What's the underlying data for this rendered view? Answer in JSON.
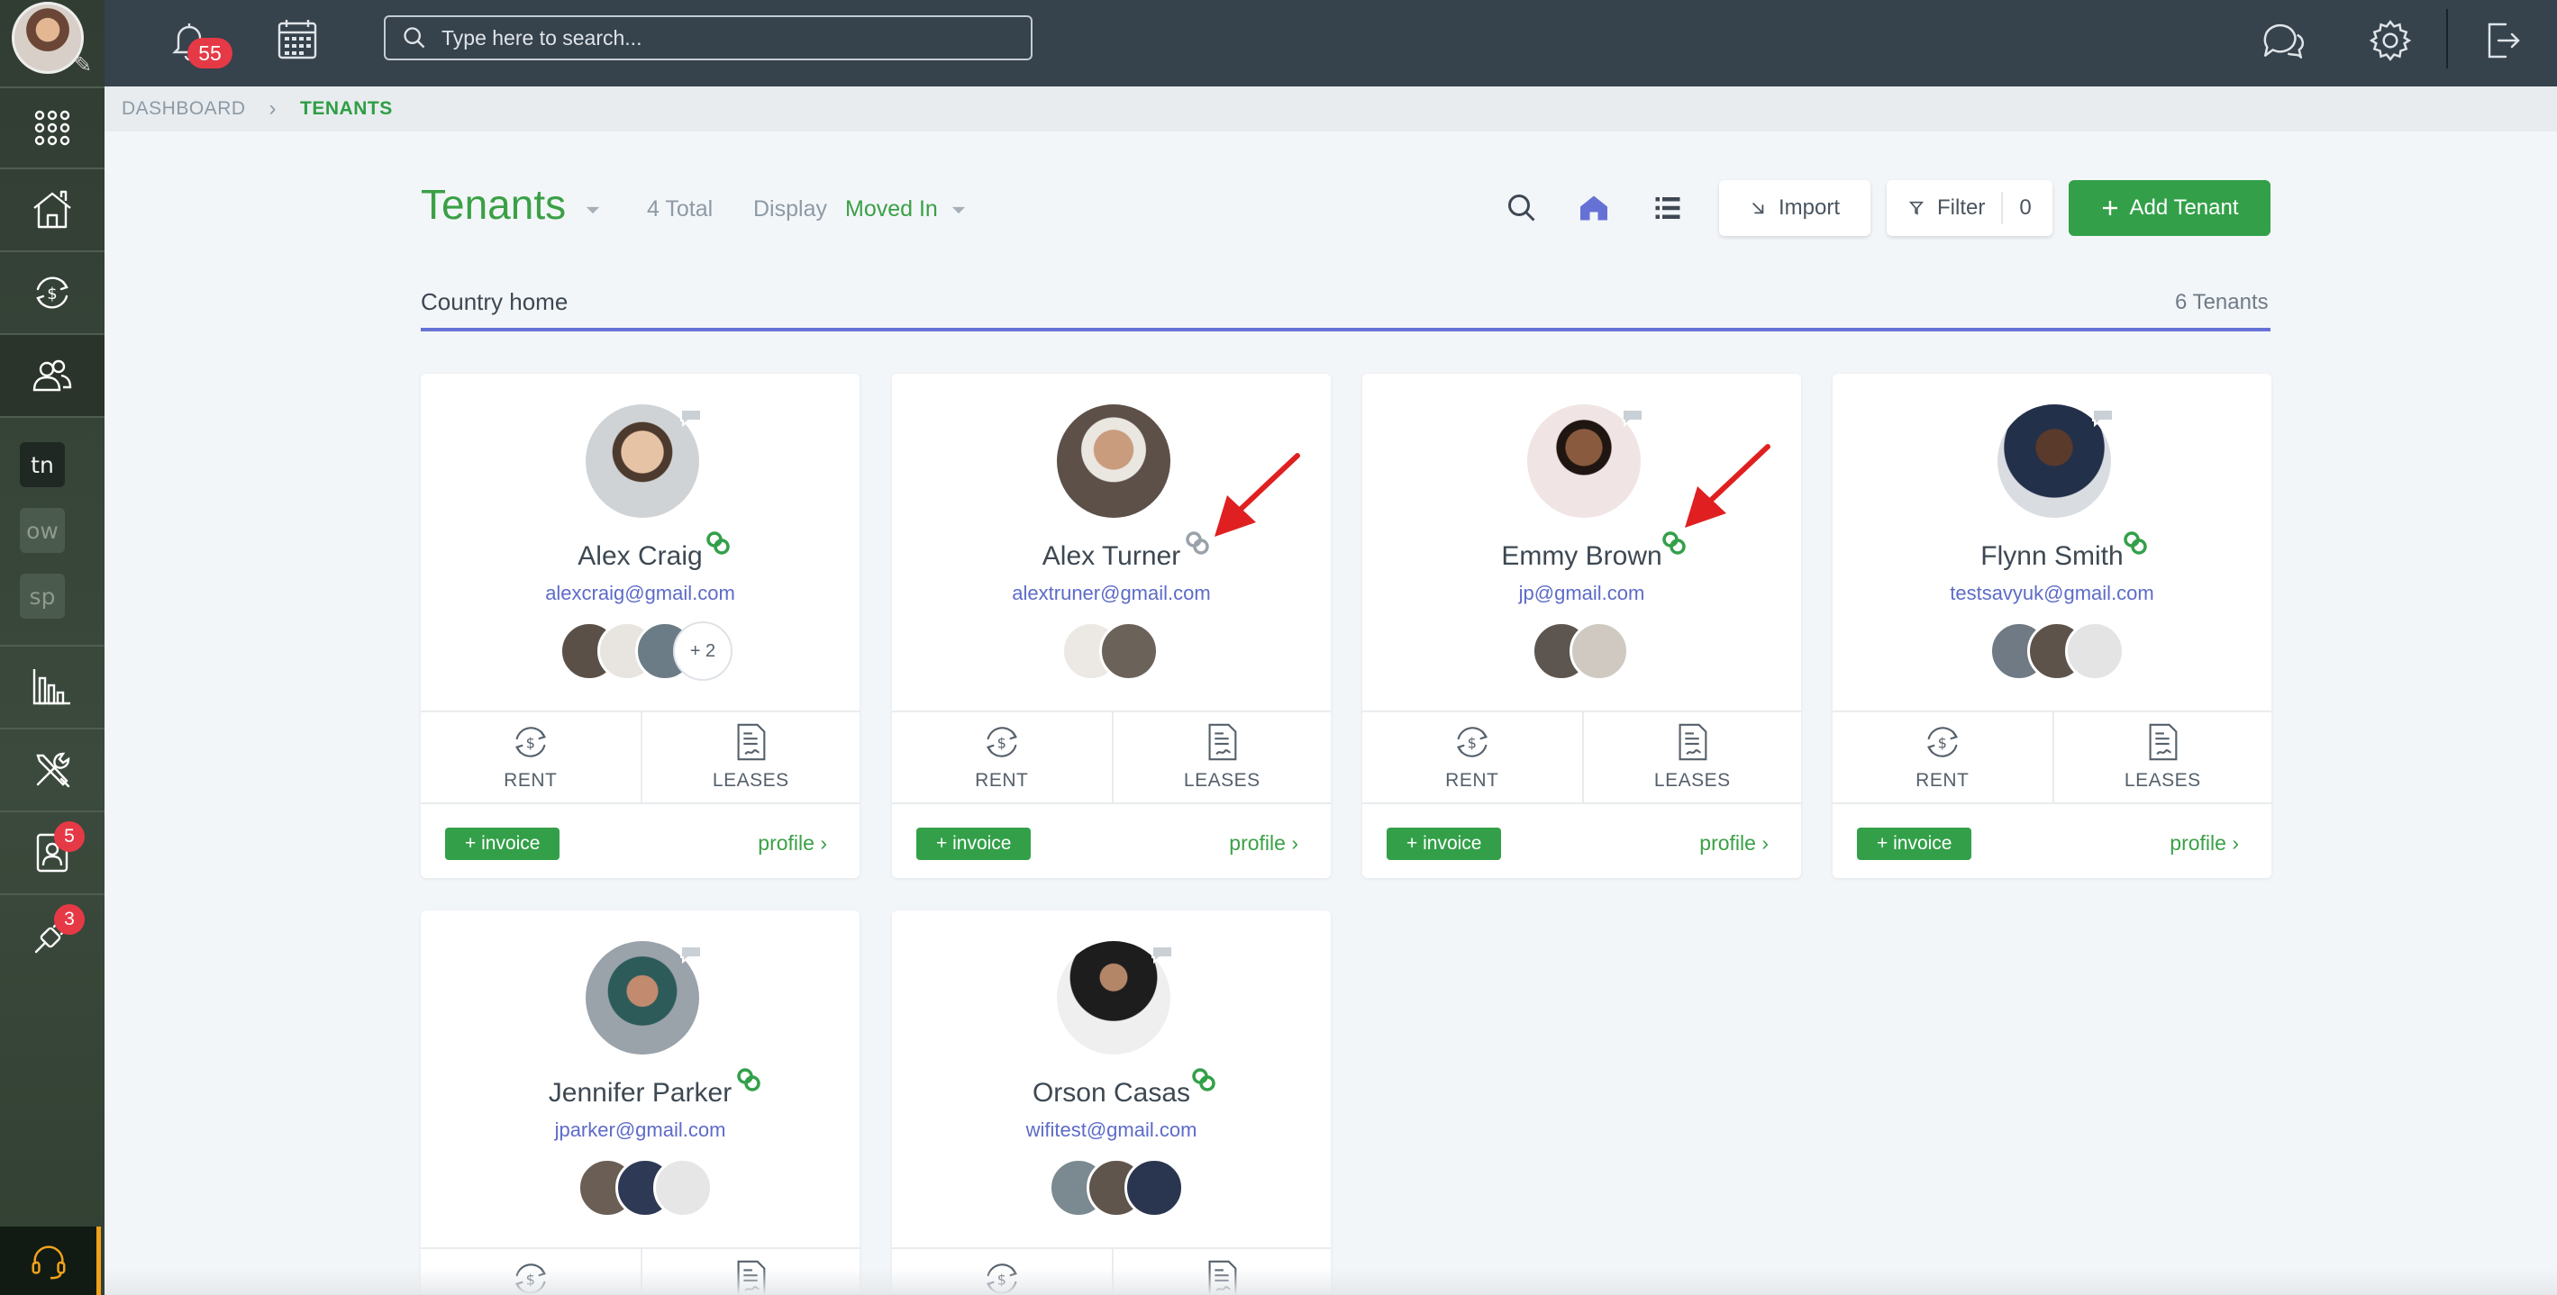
{
  "topbar": {
    "notification_count": "55",
    "search_placeholder": "Type here to search..."
  },
  "sidebar": {
    "tags": [
      "tn",
      "ow",
      "sp"
    ],
    "contacts_badge": "5",
    "tools_badge": "3"
  },
  "breadcrumb": {
    "home": "DASHBOARD",
    "separator": "›",
    "current": "TENANTS"
  },
  "header": {
    "title": "Tenants",
    "total": "4 Total",
    "display_label": "Display",
    "display_value": "Moved In",
    "import_label": "Import",
    "filter_label": "Filter",
    "filter_count": "0",
    "add_label": "Add Tenant"
  },
  "group": {
    "name": "Country home",
    "count": "6 Tenants"
  },
  "labels": {
    "rent": "RENT",
    "leases": "LEASES",
    "invoice": "+ invoice",
    "profile": "profile ›",
    "more_people": "+ 2"
  },
  "tenants": [
    {
      "name": "Alex Craig",
      "email": "alexcraig@gmail.com",
      "link_status": "connected"
    },
    {
      "name": "Alex Turner",
      "email": "alextruner@gmail.com",
      "link_status": "not-connected"
    },
    {
      "name": "Emmy Brown",
      "email": "jp@gmail.com",
      "link_status": "connected"
    },
    {
      "name": "Flynn Smith",
      "email": "testsavyuk@gmail.com",
      "link_status": "connected"
    },
    {
      "name": "Jennifer Parker",
      "email": "jparker@gmail.com",
      "link_status": "connected"
    },
    {
      "name": "Orson Casas",
      "email": "wifitest@gmail.com",
      "link_status": "connected"
    }
  ],
  "colors": {
    "brand_green": "#33a049",
    "accent_blue": "#6671d6",
    "email_blue": "#5d6bc9",
    "topbar": "#36424c",
    "alert_red": "#e63946"
  }
}
